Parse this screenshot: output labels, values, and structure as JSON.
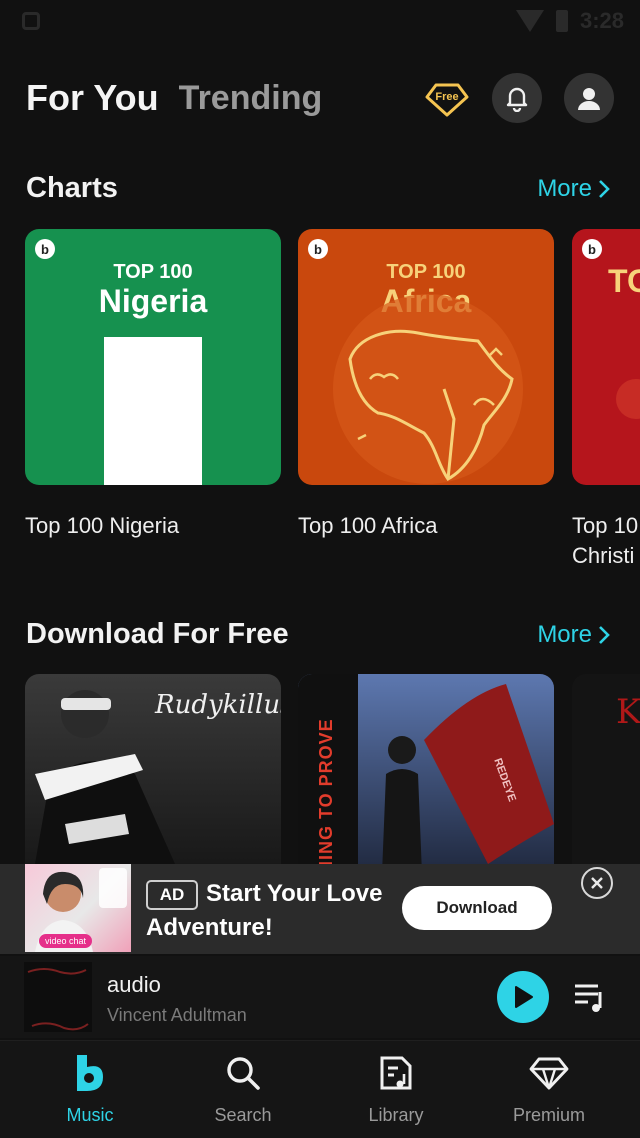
{
  "status_bar": {
    "time": "3:28"
  },
  "header": {
    "tabs": [
      {
        "label": "For You",
        "active": true
      },
      {
        "label": "Trending",
        "active": false
      }
    ],
    "free_badge": "Free"
  },
  "charts_section": {
    "title": "Charts",
    "more_label": "More",
    "cards": [
      {
        "top_text": "TOP 100",
        "big_text": "Nigeria",
        "label": "Top 100 Nigeria",
        "color": "#16914f"
      },
      {
        "top_text": "TOP 100",
        "big_text": "Africa",
        "label": "Top 100 Africa",
        "color": "#c9480d"
      },
      {
        "top_text": "TO",
        "big_text": "",
        "label": "Top 10\nChristi",
        "color": "#b5151c"
      }
    ]
  },
  "download_section": {
    "title": "Download For Free",
    "more_label": "More",
    "cards": [
      {
        "overlay_text": "Rudykillus"
      },
      {
        "overlay_text": "HING TO PROVE",
        "flag_text": "REDEYE"
      },
      {
        "overlay_text": "K"
      }
    ]
  },
  "ad": {
    "tag": "AD",
    "title_line1": "Start Your Love",
    "title_line2": "Adventure!",
    "button_label": "Download",
    "thumb_pill": "video chat"
  },
  "player": {
    "title": "audio",
    "artist": "Vincent Adultman"
  },
  "bottom_nav": {
    "items": [
      {
        "label": "Music",
        "icon": "b-logo-icon",
        "active": true
      },
      {
        "label": "Search",
        "icon": "search-icon",
        "active": false
      },
      {
        "label": "Library",
        "icon": "library-icon",
        "active": false
      },
      {
        "label": "Premium",
        "icon": "diamond-icon",
        "active": false
      }
    ]
  },
  "colors": {
    "accent": "#2ed3e6",
    "background": "#111111",
    "badge_gold": "#f5c451"
  }
}
